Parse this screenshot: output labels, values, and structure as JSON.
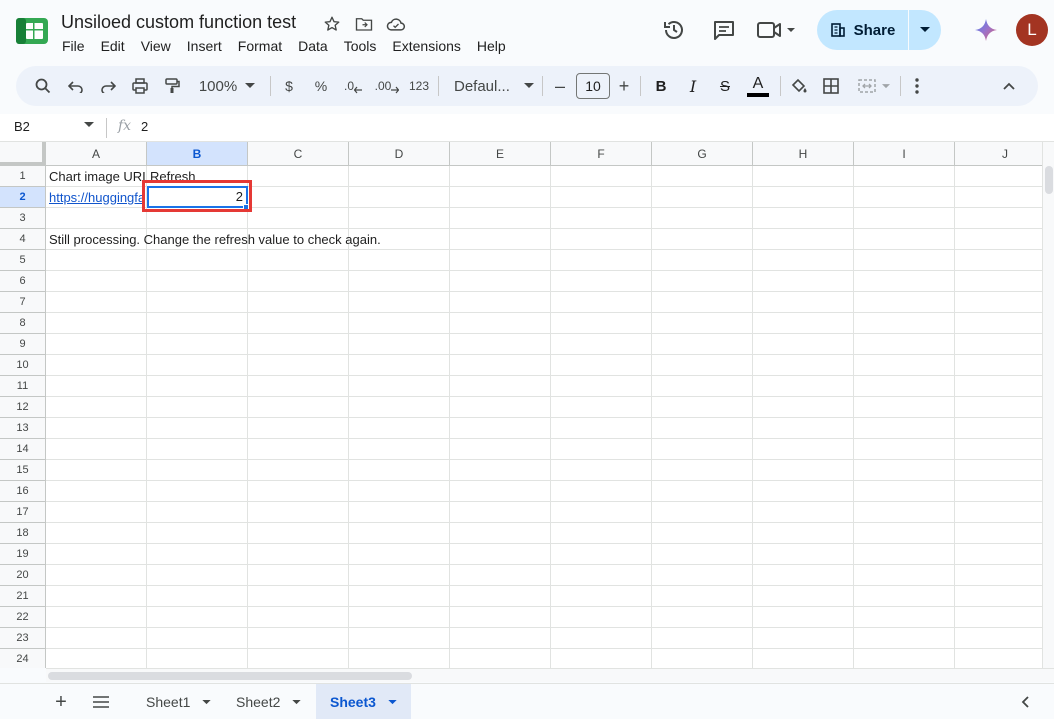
{
  "doc": {
    "title": "Unsiloed custom function test"
  },
  "menu": [
    "File",
    "Edit",
    "View",
    "Insert",
    "Format",
    "Data",
    "Tools",
    "Extensions",
    "Help"
  ],
  "actions": {
    "share_label": "Share",
    "avatar_letter": "L"
  },
  "toolbar": {
    "zoom": "100%",
    "currency": "$",
    "percent": "%",
    "dec_decrease": ".0",
    "dec_increase": ".00",
    "number_format": "123",
    "font": "Defaul...",
    "font_size": "10",
    "bold": "B",
    "italic": "I",
    "strike": "S",
    "text_color": "A"
  },
  "formula_bar": {
    "name_box": "B2",
    "fx": "fx",
    "value": "2"
  },
  "columns": [
    "A",
    "B",
    "C",
    "D",
    "E",
    "F",
    "G",
    "H",
    "I",
    "J"
  ],
  "rows": [
    "1",
    "2",
    "3",
    "4",
    "5",
    "6",
    "7",
    "8",
    "9",
    "10",
    "11",
    "12",
    "13",
    "14",
    "15",
    "16",
    "17",
    "18",
    "19",
    "20",
    "21",
    "22",
    "23",
    "24"
  ],
  "cells": {
    "A1": "Chart image URL",
    "B1": "Refresh",
    "A2": "https://huggingface",
    "B2": "2",
    "A4": "Still processing. Change the refresh value to check again."
  },
  "sheets": [
    {
      "name": "Sheet1",
      "active": false
    },
    {
      "name": "Sheet2",
      "active": false
    },
    {
      "name": "Sheet3",
      "active": true
    }
  ],
  "colors": {
    "accent": "#1a73e8",
    "highlight": "#e53935",
    "share_bg": "#c2e7ff"
  }
}
